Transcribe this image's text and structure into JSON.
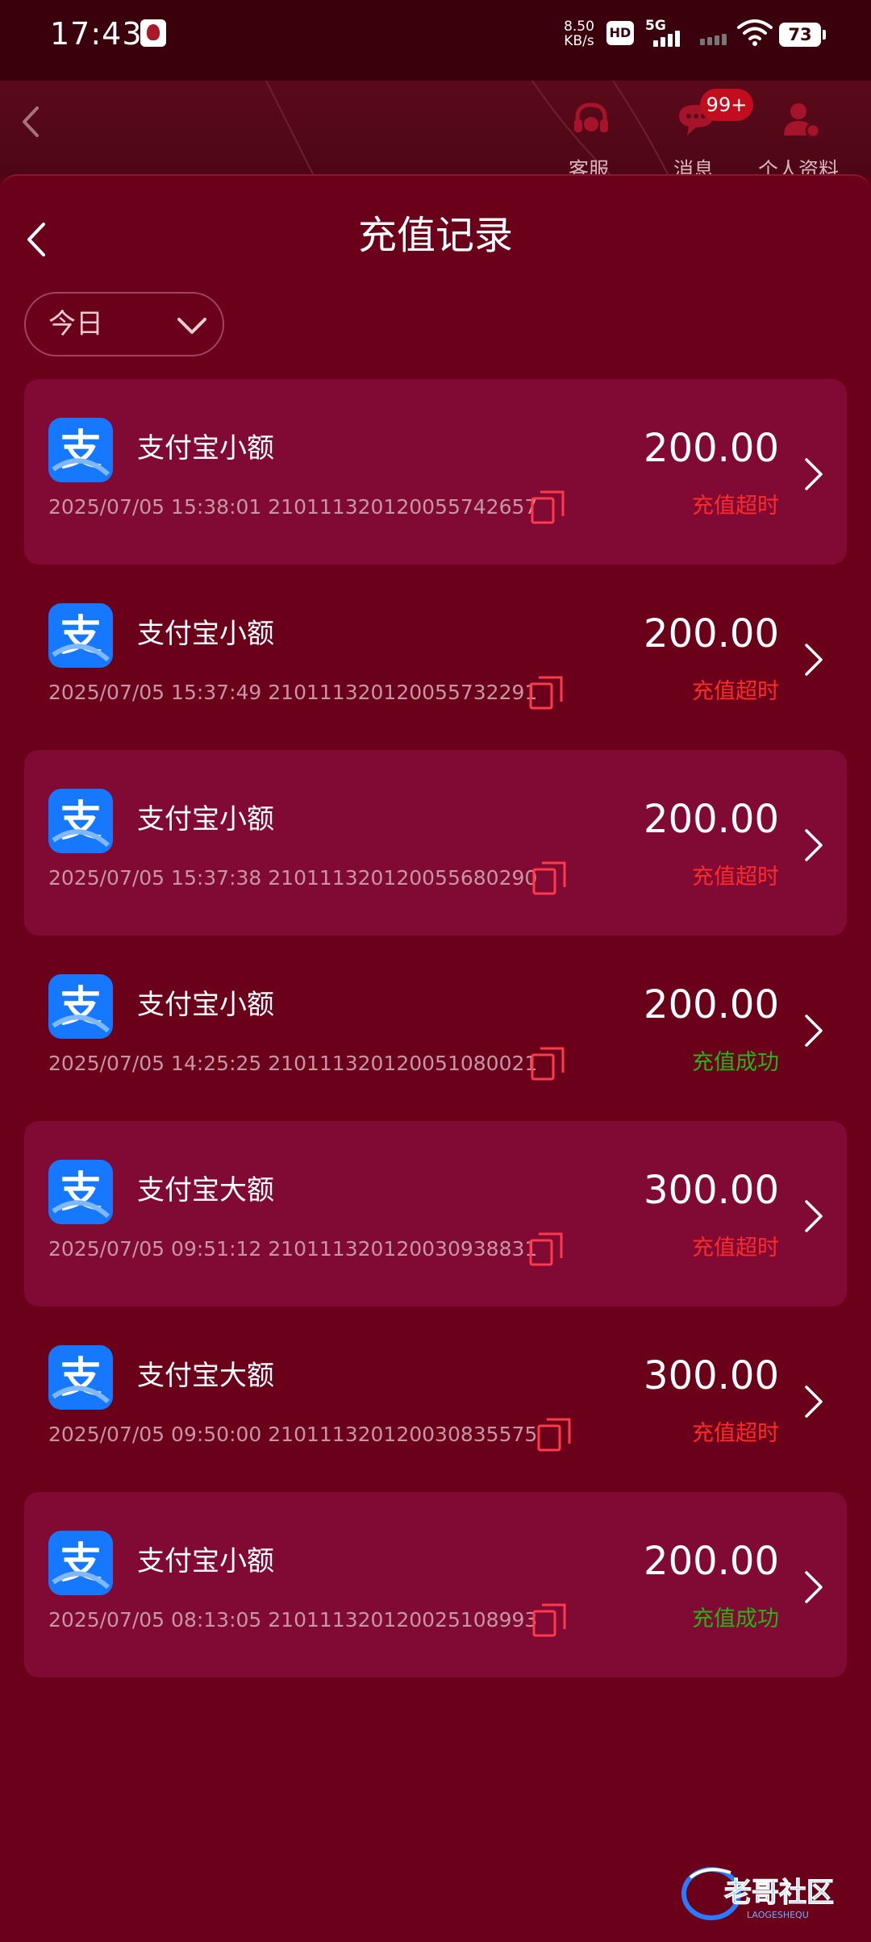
{
  "status_bar": {
    "time": "17:43",
    "net_speed_value": "8.50",
    "net_speed_unit": "KB/s",
    "hd_label": "HD",
    "network_label": "5G",
    "battery": "73"
  },
  "top_bar": {
    "customer_service_label": "客服",
    "messages_label": "消息",
    "messages_badge": "99+",
    "profile_label": "个人资料"
  },
  "page": {
    "title": "充值记录",
    "date_filter": "今日"
  },
  "records": [
    {
      "method": "支付宝小额",
      "datetime": "2025/07/05 15:38:01",
      "order_id": "2101113201200557426 57",
      "amount": "200.00",
      "status": "充值超时",
      "status_type": "timeout"
    },
    {
      "method": "支付宝小额",
      "datetime": "2025/07/05 15:37:49",
      "order_id": "210111320120055732291",
      "amount": "200.00",
      "status": "充值超时",
      "status_type": "timeout"
    },
    {
      "method": "支付宝小额",
      "datetime": "2025/07/05 15:37:38",
      "order_id": "210111320120055680290",
      "amount": "200.00",
      "status": "充值超时",
      "status_type": "timeout"
    },
    {
      "method": "支付宝小额",
      "datetime": "2025/07/05 14:25:25",
      "order_id": "210111320120051080021",
      "amount": "200.00",
      "status": "充值成功",
      "status_type": "success"
    },
    {
      "method": "支付宝大额",
      "datetime": "2025/07/05 09:51:12",
      "order_id": "210111320120030938831",
      "amount": "300.00",
      "status": "充值超时",
      "status_type": "timeout"
    },
    {
      "method": "支付宝大额",
      "datetime": "2025/07/05 09:50:00",
      "order_id": "210111320120030835575",
      "amount": "300.00",
      "status": "充值超时",
      "status_type": "timeout"
    },
    {
      "method": "支付宝小额",
      "datetime": "2025/07/05 08:13:05",
      "order_id": "210111320120025108993",
      "amount": "200.00",
      "status": "充值成功",
      "status_type": "success"
    }
  ],
  "watermark": {
    "text": "老哥社区",
    "subtext": "LAOGESHEQU"
  },
  "colors": {
    "background": "#6b001b",
    "card": "#800a33",
    "timeout": "#ff2a2a",
    "success": "#22b515",
    "alipay": "#1677ff"
  }
}
